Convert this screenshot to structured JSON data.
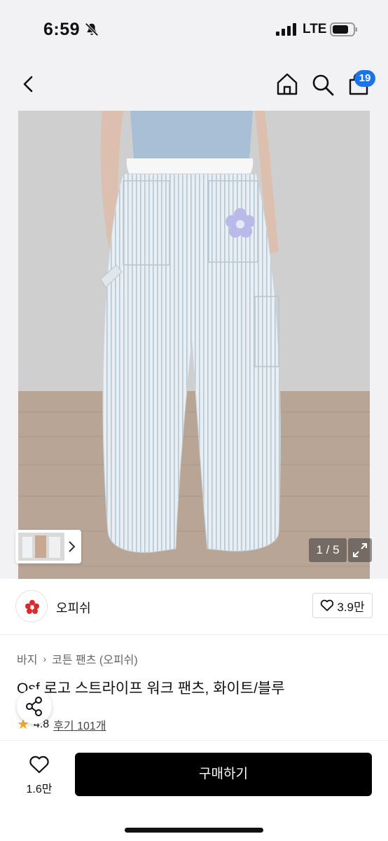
{
  "status": {
    "time": "6:59",
    "network": "LTE"
  },
  "header": {
    "cart_count": "19",
    "icons": [
      "back-icon",
      "home-icon",
      "search-icon",
      "cart-icon"
    ]
  },
  "gallery": {
    "counter": "1 / 5"
  },
  "brand": {
    "name": "오피쉬",
    "likes": "3.9만"
  },
  "product": {
    "breadcrumb": [
      "바지",
      "코튼 팬츠 (오피쉬)"
    ],
    "title": "Osf 로고 스트라이프 워크 팬츠, 화이트/블루",
    "rating": "4.8",
    "reviews": "후기 101개"
  },
  "bottom": {
    "wish_count": "1.6만",
    "buy_label": "구매하기"
  },
  "colors": {
    "accent": "#1a73e8",
    "button": "#000000",
    "star": "#f5a623"
  }
}
